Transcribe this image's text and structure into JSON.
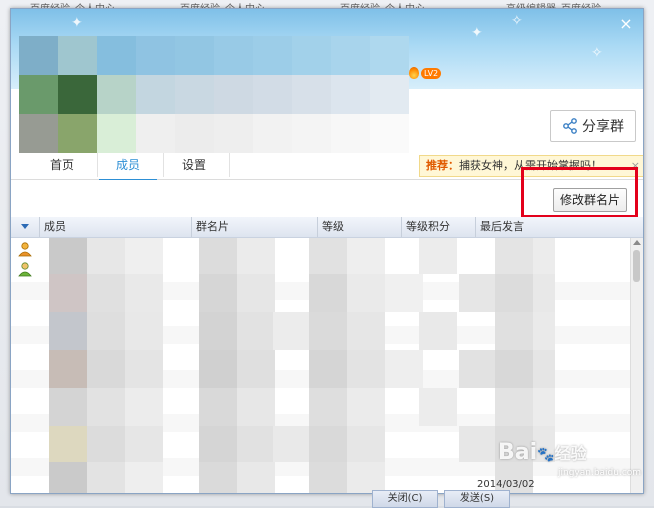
{
  "background": {
    "tabs": [
      "百度经验_个人中心",
      "百度经验_个人中心",
      "百度经验_个人中心",
      "高级编辑器_百度经验"
    ]
  },
  "window": {
    "close_glyph": "×",
    "level_badge": "LV2",
    "share_button": "分享群",
    "tabs": [
      {
        "label": "首页",
        "active": false
      },
      {
        "label": "成员",
        "active": true
      },
      {
        "label": "设置",
        "active": false
      }
    ],
    "promo": {
      "label": "推荐：",
      "text": "捕获女神，从需开始掌握吗！",
      "close_glyph": "×"
    },
    "edit_card_button": "修改群名片",
    "columns": [
      "成员",
      "群名片",
      "等级",
      "等级积分",
      "最后发言"
    ],
    "bottom_row": {
      "name": "",
      "card": "",
      "level": "",
      "last_post": "2014/03/02"
    },
    "bottom_buttons": [
      "关闭(C)",
      "发送(S)"
    ]
  },
  "watermark": {
    "text": "Bai",
    "text2": "经验",
    "sub": "jingyan.baidu.com"
  },
  "colors": {
    "accent": "#2d8fd5",
    "highlight_box": "#e3001b",
    "promo_label": "#e05a00"
  },
  "icons": {
    "close": "close-icon",
    "share": "share-icon",
    "member": "person-icon",
    "sort": "sort-arrow-icon",
    "level": "flame-icon"
  }
}
